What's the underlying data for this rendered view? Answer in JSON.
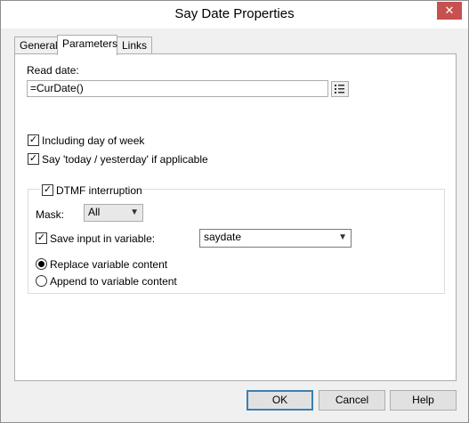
{
  "window": {
    "title": "Say Date Properties",
    "close_glyph": "✕"
  },
  "tabs": [
    {
      "label": "General"
    },
    {
      "label": "Parameters"
    },
    {
      "label": "Links"
    }
  ],
  "read_date": {
    "label": "Read date:",
    "value": "=CurDate()"
  },
  "options": {
    "include_day_label": "Including day of week",
    "include_day_checked": true,
    "say_today_label": "Say 'today / yesterday' if applicable",
    "say_today_checked": true
  },
  "dtmf": {
    "label": "DTMF interruption",
    "checked": true,
    "mask_label": "Mask:",
    "mask_value": "All",
    "save_input_label": "Save input in variable:",
    "save_input_checked": true,
    "variable_value": "saydate",
    "replace_label": "Replace variable content",
    "append_label": "Append to variable content",
    "selected_mode": "replace"
  },
  "buttons": {
    "ok": "OK",
    "cancel": "Cancel",
    "help": "Help"
  },
  "colors": {
    "close_button": "#c75050",
    "default_button_border": "#3c7fb1"
  }
}
